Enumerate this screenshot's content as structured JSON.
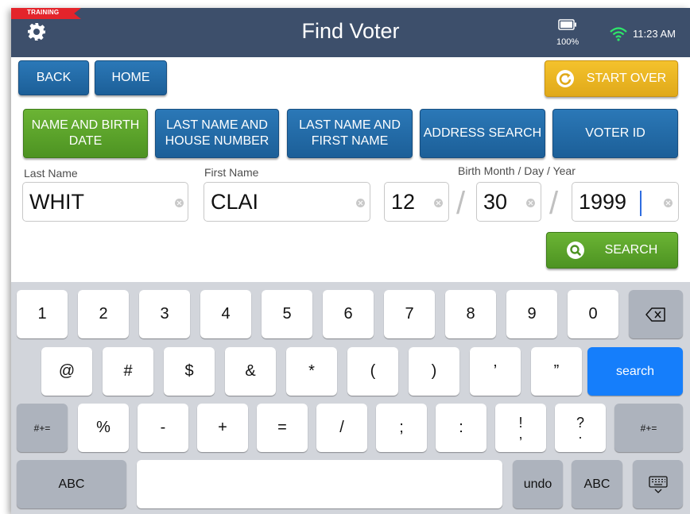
{
  "header": {
    "training_label": "TRAINING",
    "title": "Find Voter",
    "battery_pct": "100%",
    "time": "11:23 AM",
    "icons": [
      "gear-icon",
      "battery-icon",
      "wifi-icon"
    ]
  },
  "nav": {
    "back_label": "BACK",
    "home_label": "HOME",
    "start_over_label": "START OVER"
  },
  "tabs": [
    {
      "label": "NAME AND BIRTH DATE",
      "active": true
    },
    {
      "label": "LAST NAME AND HOUSE NUMBER",
      "active": false
    },
    {
      "label": "LAST NAME AND FIRST NAME",
      "active": false
    },
    {
      "label": "ADDRESS SEARCH",
      "active": false
    },
    {
      "label": "VOTER ID",
      "active": false
    }
  ],
  "form": {
    "last_name_label": "Last Name",
    "last_name_value": "WHIT",
    "first_name_label": "First Name",
    "first_name_value": "CLAI",
    "birth_label": "Birth Month / Day / Year",
    "month_value": "12",
    "day_value": "30",
    "year_value": "1999",
    "separator": "/",
    "search_label": "SEARCH"
  },
  "keyboard": {
    "row1": [
      "1",
      "2",
      "3",
      "4",
      "5",
      "6",
      "7",
      "8",
      "9",
      "0"
    ],
    "row2": [
      "@",
      "#",
      "$",
      "&",
      "*",
      "(",
      ")",
      "’",
      "”"
    ],
    "search_key": "search",
    "row3_shift": "#+=",
    "row3": [
      "%",
      "-",
      "+",
      "=",
      "/",
      ";",
      ":"
    ],
    "row3_stacked": [
      [
        "!",
        ","
      ],
      [
        "?",
        "."
      ]
    ],
    "abc_label": "ABC",
    "undo_label": "undo"
  },
  "colors": {
    "header_bg": "#3d4f6b",
    "primary_blue": "#1f67a4",
    "active_green": "#5aa52a",
    "start_over_gold": "#eab624",
    "training_red": "#e4242b",
    "wifi_green": "#2ee86a",
    "ios_blue": "#157efb"
  }
}
